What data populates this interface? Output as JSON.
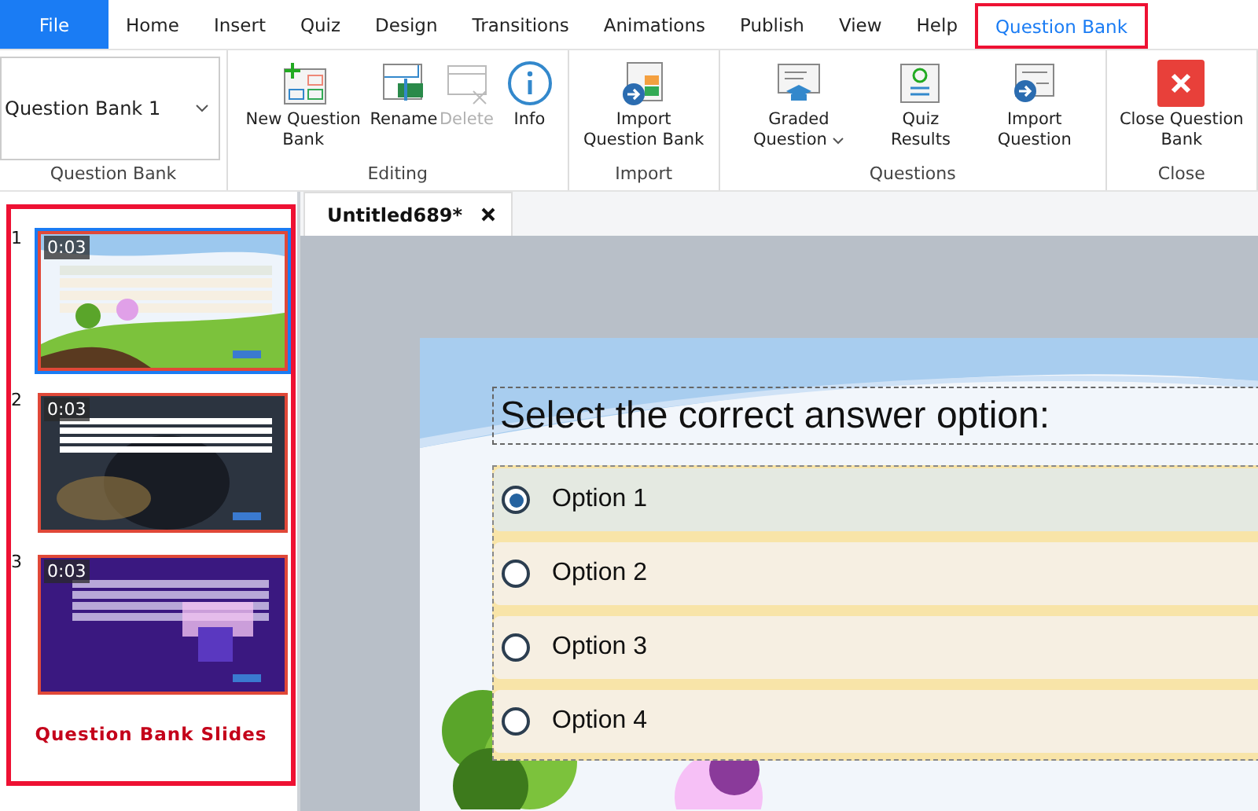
{
  "menu_tabs": [
    {
      "label": "File",
      "kind": "file",
      "selected": false,
      "highlighted": false
    },
    {
      "label": "Home",
      "kind": "tab",
      "selected": false,
      "highlighted": false
    },
    {
      "label": "Insert",
      "kind": "tab",
      "selected": false,
      "highlighted": false
    },
    {
      "label": "Quiz",
      "kind": "tab",
      "selected": false,
      "highlighted": false
    },
    {
      "label": "Design",
      "kind": "tab",
      "selected": false,
      "highlighted": false
    },
    {
      "label": "Transitions",
      "kind": "tab",
      "selected": false,
      "highlighted": false
    },
    {
      "label": "Animations",
      "kind": "tab",
      "selected": false,
      "highlighted": false
    },
    {
      "label": "Publish",
      "kind": "tab",
      "selected": false,
      "highlighted": false
    },
    {
      "label": "View",
      "kind": "tab",
      "selected": false,
      "highlighted": false
    },
    {
      "label": "Help",
      "kind": "tab",
      "selected": false,
      "highlighted": false
    },
    {
      "label": "Question Bank",
      "kind": "tab",
      "selected": true,
      "highlighted": true
    }
  ],
  "ribbon": {
    "groups": [
      {
        "label": "Question Bank",
        "kind": "dropdown",
        "value": "Question Bank 1"
      },
      {
        "label": "Editing",
        "kind": "buttons",
        "buttons": [
          {
            "label": "New Question Bank",
            "disabled": false,
            "dropdown": false
          },
          {
            "label": "Rename",
            "disabled": false,
            "dropdown": false
          },
          {
            "label": "Delete",
            "disabled": true,
            "dropdown": false
          },
          {
            "label": "Info",
            "disabled": false,
            "dropdown": false
          }
        ]
      },
      {
        "label": "Import",
        "kind": "buttons",
        "buttons": [
          {
            "label": "Import Question Bank",
            "disabled": false,
            "dropdown": false
          }
        ]
      },
      {
        "label": "Questions",
        "kind": "buttons",
        "buttons": [
          {
            "label": "Graded Question",
            "disabled": false,
            "dropdown": true
          },
          {
            "label": "Quiz Results",
            "disabled": false,
            "dropdown": false
          },
          {
            "label": "Import Question",
            "disabled": false,
            "dropdown": false
          }
        ]
      },
      {
        "label": "Close",
        "kind": "buttons",
        "buttons": [
          {
            "label": "Close Question Bank",
            "disabled": false,
            "dropdown": false
          }
        ]
      }
    ]
  },
  "slides_panel": {
    "highlighted": true,
    "caption": "Question Bank Slides",
    "slides": [
      {
        "number": "1",
        "duration": "0:03",
        "selected": true
      },
      {
        "number": "2",
        "duration": "0:03",
        "selected": false
      },
      {
        "number": "3",
        "duration": "0:03",
        "selected": false
      }
    ]
  },
  "document_tab": {
    "title": "Untitled689*"
  },
  "slide": {
    "question": "Select the correct answer option:",
    "options": [
      {
        "label": "Option 1",
        "selected": true
      },
      {
        "label": "Option 2",
        "selected": false
      },
      {
        "label": "Option 3",
        "selected": false
      },
      {
        "label": "Option 4",
        "selected": false
      }
    ]
  }
}
